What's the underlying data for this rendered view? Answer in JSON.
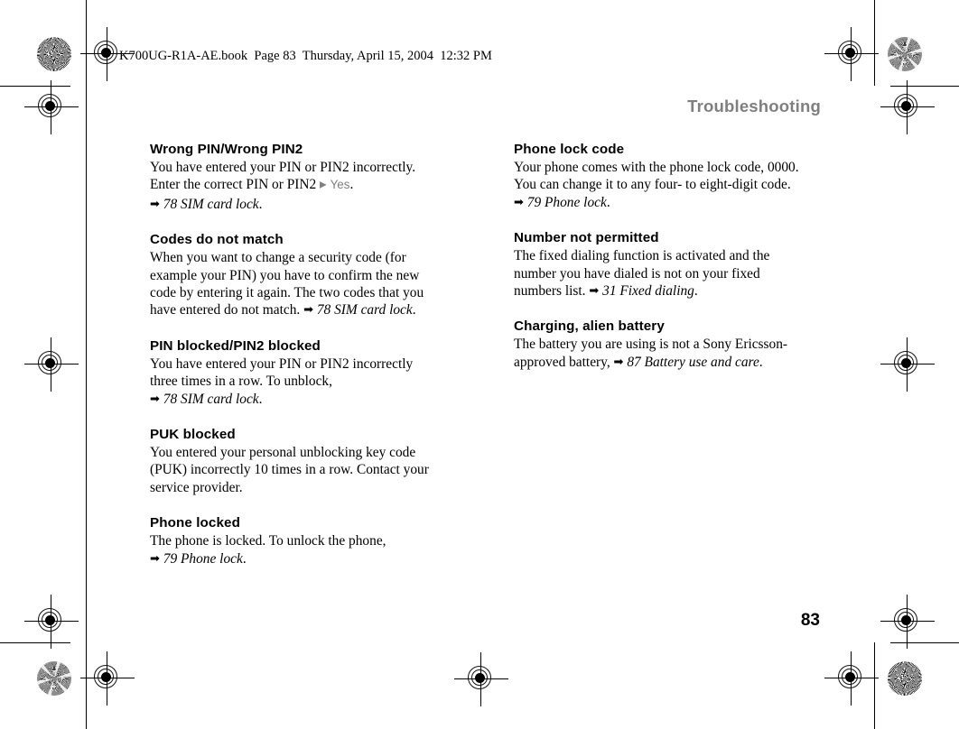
{
  "document": {
    "file_stamp": "K700UG-R1A-AE.book  Page 83  Thursday, April 15, 2004  12:32 PM",
    "running_header": "Troubleshooting",
    "page_number": "83"
  },
  "marks": {
    "registration_icon": "registration-crosshair",
    "star_target_icon": "star-density-target"
  },
  "glyphs": {
    "xref_arrow": "➡",
    "softkey_triangle": "▶"
  },
  "columns": [
    {
      "id": "left",
      "blocks": [
        {
          "heading": "Wrong PIN/Wrong PIN2",
          "lines": [
            {
              "type": "text",
              "text": "You have entered your PIN or PIN2 incorrectly."
            },
            {
              "type": "softkey_line",
              "before": "Enter the correct PIN or PIN2 ",
              "softkey": "Yes",
              "after": "."
            },
            {
              "type": "xref_line",
              "before": "",
              "xref": "78 SIM card lock",
              "after": "."
            }
          ]
        },
        {
          "heading": "Codes do not match",
          "lines": [
            {
              "type": "text",
              "text": "When you want to change a security code (for"
            },
            {
              "type": "text",
              "text": "example your PIN) you have to confirm the new"
            },
            {
              "type": "text",
              "text": "code by entering it again. The two codes that you"
            },
            {
              "type": "xref_line",
              "before": "have entered do not match. ",
              "xref": "78 SIM card lock",
              "after": "."
            }
          ]
        },
        {
          "heading": "PIN blocked/PIN2 blocked",
          "lines": [
            {
              "type": "text",
              "text": "You have entered your PIN or PIN2 incorrectly"
            },
            {
              "type": "text",
              "text": "three times in a row. To unblock,"
            },
            {
              "type": "xref_line",
              "before": "",
              "xref": "78 SIM card lock",
              "after": "."
            }
          ]
        },
        {
          "heading": "PUK blocked",
          "lines": [
            {
              "type": "text",
              "text": "You entered your personal unblocking key code"
            },
            {
              "type": "text",
              "text": "(PUK) incorrectly 10 times in a row. Contact your"
            },
            {
              "type": "text",
              "text": "service provider."
            }
          ]
        },
        {
          "heading": "Phone locked",
          "lines": [
            {
              "type": "text",
              "text": "The phone is locked. To unlock the phone,"
            },
            {
              "type": "xref_line",
              "before": "",
              "xref": "79 Phone lock",
              "after": "."
            }
          ]
        }
      ]
    },
    {
      "id": "right",
      "blocks": [
        {
          "heading": "Phone lock code",
          "lines": [
            {
              "type": "text",
              "text": "Your phone comes with the phone lock code, 0000."
            },
            {
              "type": "text",
              "text": "You can change it to any four- to eight-digit code."
            },
            {
              "type": "xref_line",
              "before": "",
              "xref": "79 Phone lock",
              "after": "."
            }
          ]
        },
        {
          "heading": "Number not permitted",
          "lines": [
            {
              "type": "text",
              "text": "The fixed dialing function is activated and the"
            },
            {
              "type": "text",
              "text": "number you have dialed is not on your fixed"
            },
            {
              "type": "xref_line",
              "before": "numbers list. ",
              "xref": "31 Fixed dialing",
              "after": "."
            }
          ]
        },
        {
          "heading": "Charging, alien battery",
          "lines": [
            {
              "type": "text",
              "text": "The battery you are using is not a Sony Ericsson-"
            },
            {
              "type": "xref_line",
              "before": "approved battery, ",
              "xref": "87 Battery use and care",
              "after": "."
            }
          ]
        }
      ]
    }
  ]
}
